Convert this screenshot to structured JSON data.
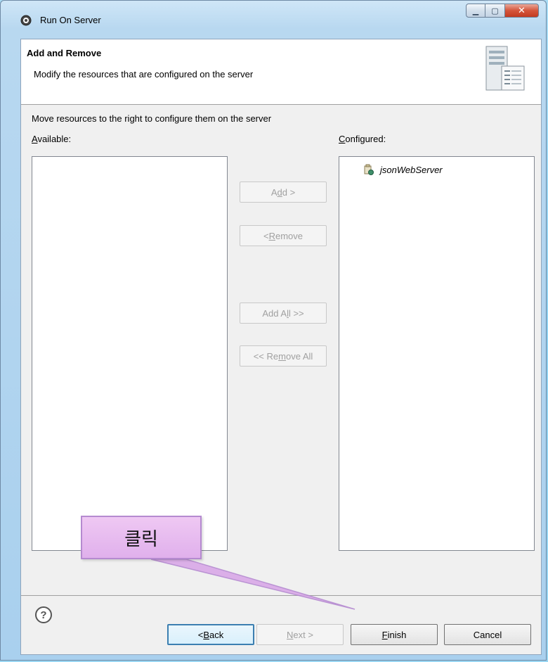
{
  "window": {
    "title": "Run On Server"
  },
  "header": {
    "title": "Add and Remove",
    "description": "Modify the resources that are configured on the server"
  },
  "instruction": "Move resources to the right to configure them on the server",
  "available": {
    "label_mnemonic": "A",
    "label_rest": "vailable:",
    "items": []
  },
  "configured": {
    "label_mnemonic": "C",
    "label_rest": "onfigured:",
    "items": [
      "jsonWebServer"
    ]
  },
  "buttons": {
    "add": {
      "pre": "A",
      "mn": "d",
      "post": "d >"
    },
    "remove": {
      "pre": "< ",
      "mn": "R",
      "post": "emove"
    },
    "add_all": {
      "pre": "Add A",
      "mn": "l",
      "post": "l >>"
    },
    "remove_all": {
      "pre": "<< Re",
      "mn": "m",
      "post": "ove All"
    },
    "back": {
      "pre": "< ",
      "mn": "B",
      "post": "ack"
    },
    "next": {
      "pre": "",
      "mn": "N",
      "post": "ext >"
    },
    "finish": {
      "pre": "",
      "mn": "F",
      "post": "inish"
    },
    "cancel": "Cancel"
  },
  "callout": {
    "text": "클릭",
    "color": "#e6b8ef"
  },
  "icons": {
    "app": "eclipse-server-icon",
    "header": "server-wizard-icon",
    "help": "help-icon",
    "tree": "web-project-icon"
  }
}
